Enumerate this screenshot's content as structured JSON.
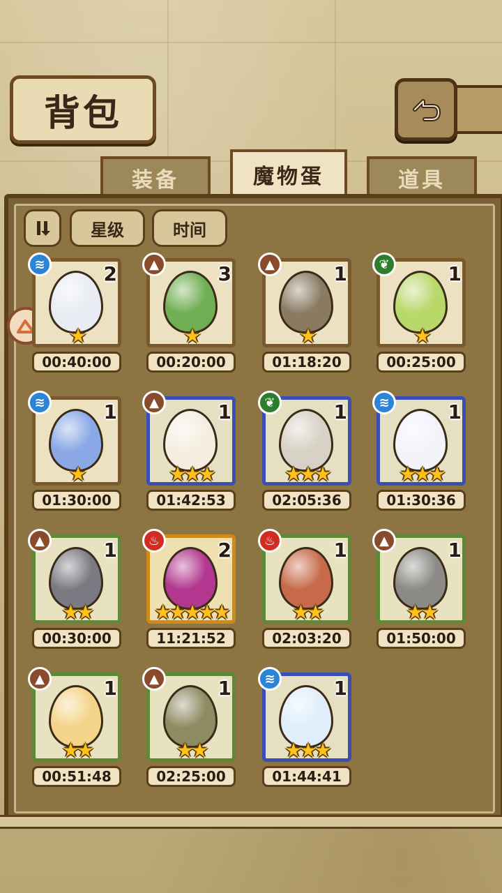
{
  "header": {
    "title": "背包",
    "back_icon": "back-arrow-icon"
  },
  "tabs": [
    {
      "label": "装备",
      "active": false
    },
    {
      "label": "魔物蛋",
      "active": true
    },
    {
      "label": "道具",
      "active": false
    }
  ],
  "sort": {
    "toggle_icon": "sort-toggle-icon",
    "star_label": "星级",
    "time_label": "时间"
  },
  "eggs": [
    {
      "element": "water",
      "count": "2",
      "stars": "★",
      "time": "00:40:00",
      "color": "#e9ecf2"
    },
    {
      "element": "earth",
      "count": "3",
      "stars": "★",
      "time": "00:20:00",
      "color": "#6fae52"
    },
    {
      "element": "earth",
      "count": "1",
      "stars": "★",
      "time": "01:18:20",
      "color": "#8a7a62"
    },
    {
      "element": "plant",
      "count": "1",
      "stars": "★",
      "time": "00:25:00",
      "color": "#b9d86a"
    },
    {
      "element": "water",
      "count": "1",
      "stars": "★",
      "time": "01:30:00",
      "color": "#8aa8e6"
    },
    {
      "element": "earth",
      "count": "1",
      "stars": "★★★",
      "time": "01:42:53",
      "color": "#f5eee0"
    },
    {
      "element": "plant",
      "count": "1",
      "stars": "★★★",
      "time": "02:05:36",
      "color": "#d8d2c6"
    },
    {
      "element": "water",
      "count": "1",
      "stars": "★★★",
      "time": "01:30:36",
      "color": "#f2f4fa"
    },
    {
      "element": "earth",
      "count": "1",
      "stars": "★★",
      "time": "00:30:00",
      "color": "#7a7a82"
    },
    {
      "element": "fire",
      "count": "2",
      "stars": "★★★★★",
      "time": "11:21:52",
      "color": "#b2378e"
    },
    {
      "element": "fire",
      "count": "1",
      "stars": "★★",
      "time": "02:03:20",
      "color": "#c66a4a"
    },
    {
      "element": "earth",
      "count": "1",
      "stars": "★★",
      "time": "01:50:00",
      "color": "#8c8a86"
    },
    {
      "element": "earth",
      "count": "1",
      "stars": "★★",
      "time": "00:51:48",
      "color": "#f4d488"
    },
    {
      "element": "earth",
      "count": "1",
      "stars": "★★",
      "time": "02:25:00",
      "color": "#8e8a62"
    },
    {
      "element": "water",
      "count": "1",
      "stars": "★★★",
      "time": "01:44:41",
      "color": "#dfeefa"
    }
  ]
}
